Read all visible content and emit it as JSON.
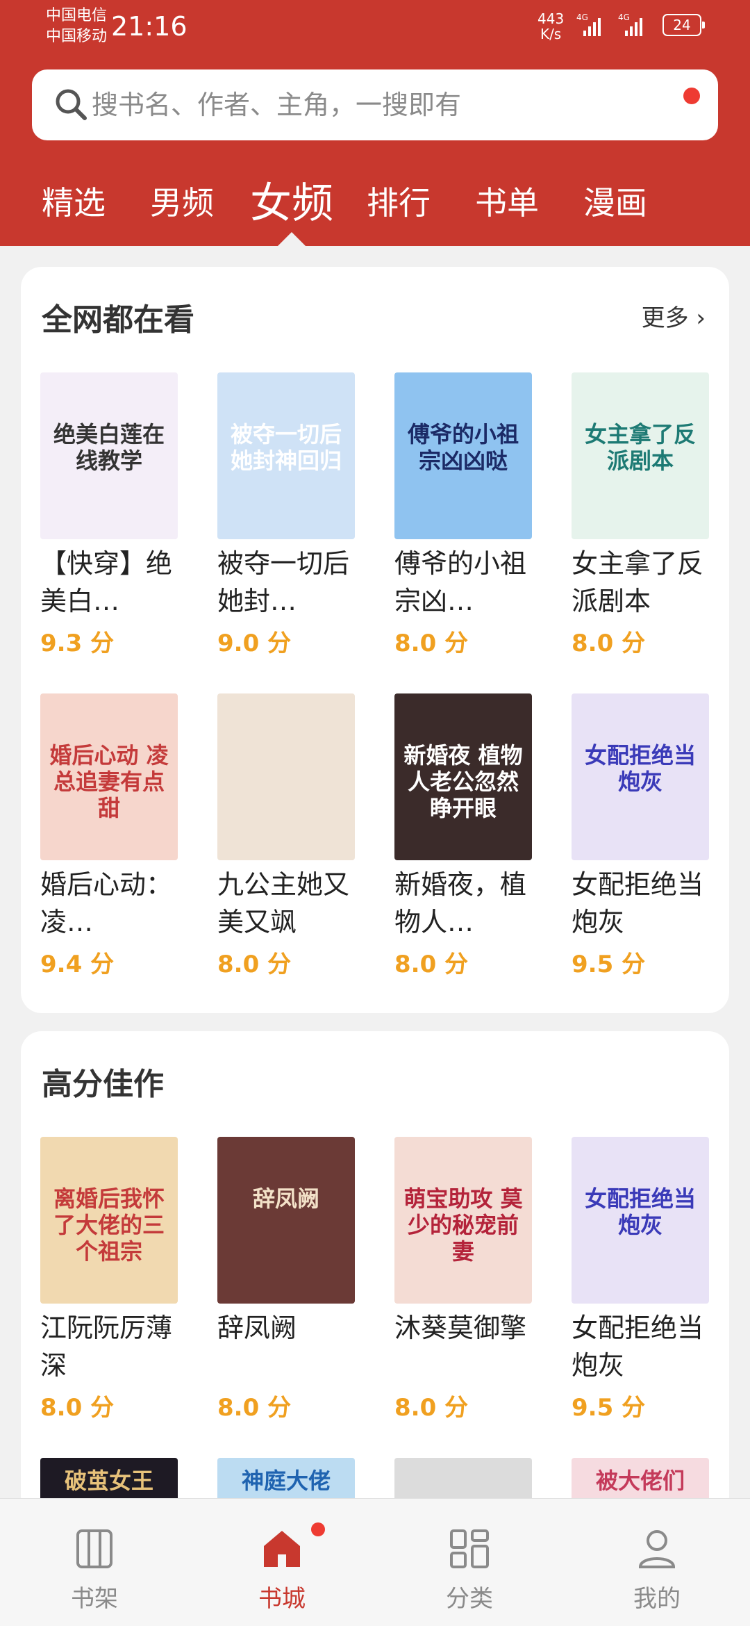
{
  "status_bar": {
    "carrier1": "中国电信",
    "carrier2": "中国移动",
    "time": "21:16",
    "net_speed_value": "443",
    "net_speed_unit": "K/s",
    "signal1_label": "4G",
    "signal2_label": "4G",
    "battery": "24"
  },
  "search": {
    "placeholder": "搜书名、作者、主角，一搜即有"
  },
  "tabs": [
    {
      "label": "精选"
    },
    {
      "label": "男频"
    },
    {
      "label": "女频"
    },
    {
      "label": "排行"
    },
    {
      "label": "书单"
    },
    {
      "label": "漫画"
    }
  ],
  "section1": {
    "title": "全网都在看",
    "more_label": "更多",
    "books": [
      {
        "title": "【快穿】绝美白…",
        "score": "9.3 分",
        "cover_text": "绝美白莲在线教学",
        "cover_color": "#f4eef8"
      },
      {
        "title": "被夺一切后她封…",
        "score": "9.0 分",
        "cover_text": "被夺一切后她封神回归",
        "cover_color": "#cfe2f6"
      },
      {
        "title": "傅爷的小祖宗凶…",
        "score": "8.0 分",
        "cover_text": "傅爷的小祖宗凶凶哒",
        "cover_color": "#8fc3f0"
      },
      {
        "title": "女主拿了反派剧本",
        "score": "8.0 分",
        "cover_text": "女主拿了反派剧本",
        "cover_color": "#e6f3ec"
      },
      {
        "title": "婚后心动：凌…",
        "score": "9.4 分",
        "cover_text": "婚后心动 凌总追妻有点甜",
        "cover_color": "#f6d6cc"
      },
      {
        "title": "九公主她又美又飒",
        "score": "8.0 分",
        "cover_text": "",
        "cover_color": "#efe3d6"
      },
      {
        "title": "新婚夜，植物人…",
        "score": "8.0 分",
        "cover_text": "新婚夜 植物人老公忽然睁开眼",
        "cover_color": "#3b2b2a"
      },
      {
        "title": "女配拒绝当炮灰",
        "score": "9.5 分",
        "cover_text": "女配拒绝当炮灰",
        "cover_color": "#e8e2f6"
      }
    ]
  },
  "section2": {
    "title": "高分佳作",
    "books": [
      {
        "title": "江阮阮厉薄深",
        "score": "8.0 分",
        "cover_text": "离婚后我怀了大佬的三个祖宗",
        "cover_color": "#f1d9b0"
      },
      {
        "title": "辞凤阙",
        "score": "8.0 分",
        "cover_text": "辞凤阙",
        "cover_color": "#6b3a36"
      },
      {
        "title": "沐葵莫御擎",
        "score": "8.0 分",
        "cover_text": "萌宝助攻 莫少的秘宠前妻",
        "cover_color": "#f4dcd4"
      },
      {
        "title": "女配拒绝当炮灰",
        "score": "9.5 分",
        "cover_text": "女配拒绝当炮灰",
        "cover_color": "#e8e2f6"
      }
    ],
    "next_row_covers": [
      {
        "cover_text": "破茧女王",
        "cover_color": "#1e1a24"
      },
      {
        "cover_text": "神庭大佬",
        "cover_color": "#bcdcf2"
      },
      {
        "cover_text": "",
        "cover_color": "#dcdcdc"
      },
      {
        "cover_text": "被大佬们",
        "cover_color": "#f6dbe0"
      }
    ]
  },
  "bottom_nav": [
    {
      "label": "书架",
      "icon": "bookshelf-icon"
    },
    {
      "label": "书城",
      "icon": "store-house-icon"
    },
    {
      "label": "分类",
      "icon": "category-grid-icon"
    },
    {
      "label": "我的",
      "icon": "profile-icon"
    }
  ],
  "colors": {
    "brand_red": "#c8382e",
    "score_orange": "#f0a020",
    "badge_red": "#ee3b32"
  }
}
